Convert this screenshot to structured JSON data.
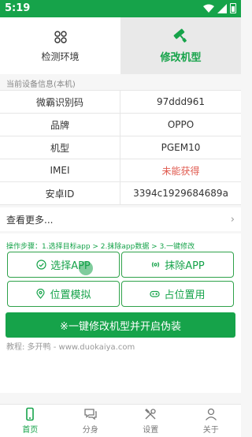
{
  "status_bar": {
    "time": "5:19"
  },
  "tabs": [
    {
      "label": "检测环境",
      "icon": "grid-icon"
    },
    {
      "label": "修改机型",
      "icon": "paint-roller-icon",
      "active": true
    }
  ],
  "section_title": "当前设备信息(本机)",
  "device_info": [
    {
      "key": "微霸识别码",
      "value": "97ddd961"
    },
    {
      "key": "品牌",
      "value": "OPPO"
    },
    {
      "key": "机型",
      "value": "PGEM10"
    },
    {
      "key": "IMEI",
      "value": "未能获得"
    },
    {
      "key": "安卓ID",
      "value": "3394c1929684689a"
    }
  ],
  "more": {
    "label": "查看更多...",
    "chevron": "›"
  },
  "steps_text": "操作步骤：1.选择目标app > 2.抹除app数据 > 3.一键修改",
  "buttons": {
    "select_app": "选择APP",
    "erase_app": "抹除APP",
    "location": "位置模拟",
    "occupy": "占位置用"
  },
  "main_button": "※一键修改机型并开启伪装",
  "tutorial": "教程: 多开鸭 - www.duokaiya.com",
  "nav": [
    {
      "label": "首页",
      "active": true
    },
    {
      "label": "分身"
    },
    {
      "label": "设置"
    },
    {
      "label": "关于"
    }
  ],
  "colors": {
    "accent": "#16a34a",
    "warn": "#e05a4f"
  }
}
